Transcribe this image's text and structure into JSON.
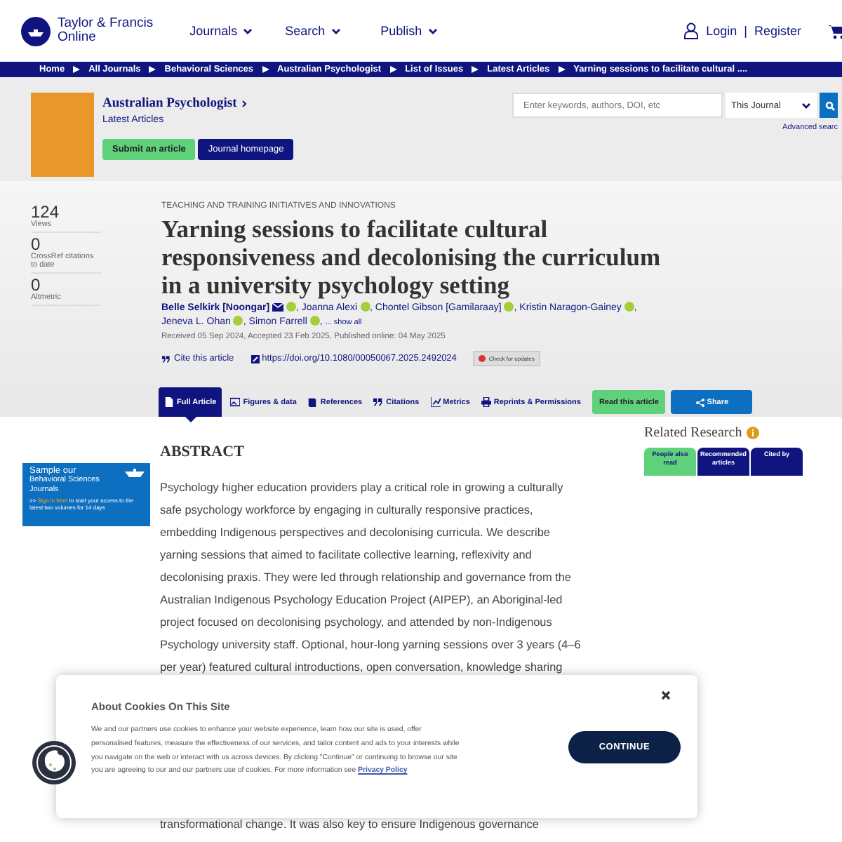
{
  "header": {
    "brand": "Taylor & Francis",
    "brand_sub": "Online",
    "nav": [
      "Journals",
      "Search",
      "Publish"
    ],
    "login": "Login",
    "separator": "|",
    "register": "Register"
  },
  "breadcrumb": [
    "Home",
    "All Journals",
    "Behavioral Sciences",
    "Australian Psychologist",
    "List of Issues",
    "Latest Articles",
    "Yarning sessions to facilitate cultural ...."
  ],
  "journal": {
    "title": "Australian Psychologist",
    "subtitle": "Latest Articles",
    "buttons": [
      {
        "label": "Submit an article",
        "kind": "green"
      },
      {
        "label": "Journal homepage",
        "kind": "navy"
      }
    ]
  },
  "search": {
    "placeholder": "Enter keywords, authors, DOI, etc",
    "scope": "This Journal",
    "advanced": "Advanced searc"
  },
  "metrics": [
    {
      "value": "124",
      "label": "Views"
    },
    {
      "value": "0",
      "label": "CrossRef citations to date"
    },
    {
      "value": "0",
      "label": "Altmetric"
    }
  ],
  "article": {
    "category": "TEACHING AND TRAINING INITIATIVES AND INNOVATIONS",
    "title": "Yarning sessions to facilitate cultural responsiveness and decolonising the curriculum in a university psychology setting",
    "authors": [
      {
        "name": "Belle Selkirk [Noongar]",
        "email": true,
        "orcid": true
      },
      {
        "name": "Joanna Alexi",
        "email": false,
        "orcid": true
      },
      {
        "name": "Chontel Gibson [Gamilaraay]",
        "email": false,
        "orcid": true
      },
      {
        "name": "Kristin Naragon-Gainey",
        "email": false,
        "orcid": true
      },
      {
        "name": "Jeneva L. Ohan",
        "email": false,
        "orcid": true
      },
      {
        "name": "Simon Farrell",
        "email": false,
        "orcid": true
      }
    ],
    "separator": ",",
    "show_all": "... show all",
    "dates": "Received 05 Sep 2024, Accepted 23 Feb 2025, Published online: 04 May 2025",
    "cite": "Cite this article",
    "doi": "https://doi.org/10.1080/00050067.2025.2492024",
    "updates": "Check for updates"
  },
  "tabs": [
    {
      "label": "Full Article",
      "kind": "doc",
      "selected": true
    },
    {
      "label": "Figures & data",
      "kind": "image",
      "selected": false
    },
    {
      "label": "References",
      "kind": "book",
      "selected": false
    },
    {
      "label": "Citations",
      "kind": "quote",
      "selected": false
    },
    {
      "label": "Metrics",
      "kind": "chart",
      "selected": false
    },
    {
      "label": "Reprints & Permissions",
      "kind": "print",
      "selected": false
    }
  ],
  "read": "Read this article",
  "share": "Share",
  "ad": {
    "title": "Sample our",
    "subtitle": "Behavioral Sciences Journals",
    "prefix": ">> ",
    "link": "Sign in here",
    "text": " to start your access to the latest two volumes for 14 days"
  },
  "abstract": {
    "heading": "ABSTRACT",
    "lines_before": [
      "Psychology higher education providers play a critical role in growing a culturally",
      "safe psychology workforce by engaging in culturally responsive practices,",
      "embedding Indigenous perspectives and decolonising curricula. We describe",
      "yarning sessions that aimed to facilitate collective learning, reflexivity and",
      "decolonising praxis. They were led through relationship and governance from the",
      "Australian Indigenous Psychology Education Project (AIPEP), an Aboriginal-led",
      "project focused on decolonising psychology, and attended by non-Indigenous",
      "Psychology university staff. Optional, hour-long yarning sessions over 3 years (4–6",
      "per year) featured cultural introductions, open conversation, knowledge sharing"
    ],
    "lines_after": [
      "transformational change. It was also key to ensure Indigenous governance"
    ]
  },
  "related": {
    "title": "Related Research",
    "tabs": [
      {
        "label": "People also read",
        "selected": true
      },
      {
        "label": "Recommended articles",
        "selected": false
      },
      {
        "label": "Cited by",
        "selected": false
      }
    ]
  },
  "cookie": {
    "title": "About Cookies On This Site",
    "text": "We and our partners use cookies to enhance your website experience, learn how our site is used, offer personalised features, measure the effectiveness of our services, and tailor content and ads to your interests while you navigate on the web or interact with us across devices. By clicking \"Continue\" or continuing to browse our site you are agreeing to our and our partners use of cookies. For more information see ",
    "link": "Privacy Policy",
    "button": "CONTINUE"
  }
}
